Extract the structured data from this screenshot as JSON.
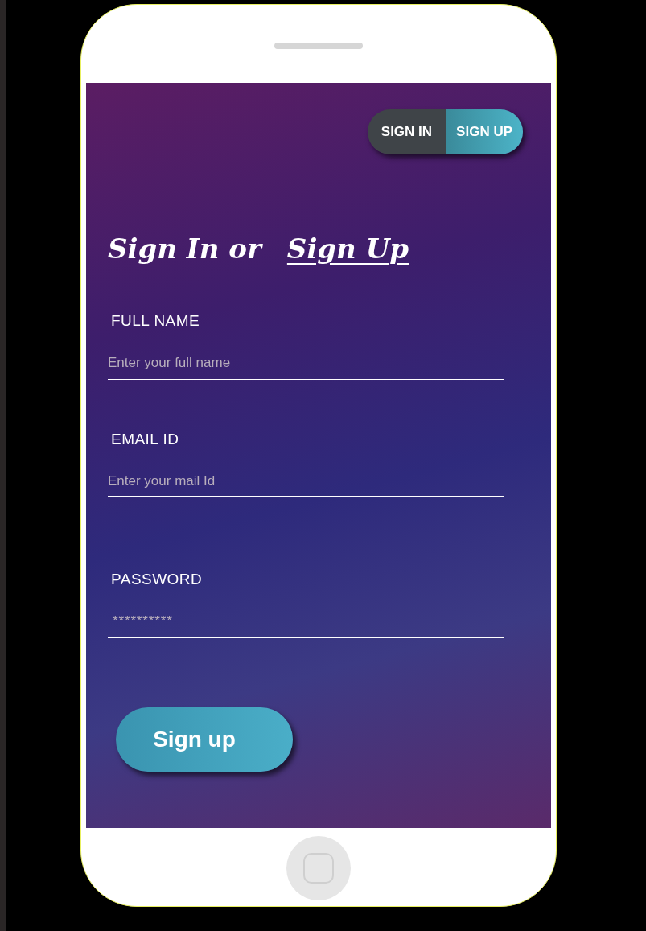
{
  "toggle": [
    {
      "label": "SIGN IN",
      "selected": false
    },
    {
      "label": "SIGN UP",
      "selected": true
    }
  ],
  "heading": {
    "text": "Sign In or",
    "link": "Sign Up"
  },
  "fields": [
    {
      "label": "FULL NAME",
      "placeholder": "Enter your full name",
      "kind": "text"
    },
    {
      "label": "EMAIL ID",
      "placeholder": "Enter your mail Id",
      "kind": "email"
    },
    {
      "label": "PASSWORD",
      "placeholder": "**********",
      "kind": "password"
    }
  ],
  "submit": "Sign up"
}
